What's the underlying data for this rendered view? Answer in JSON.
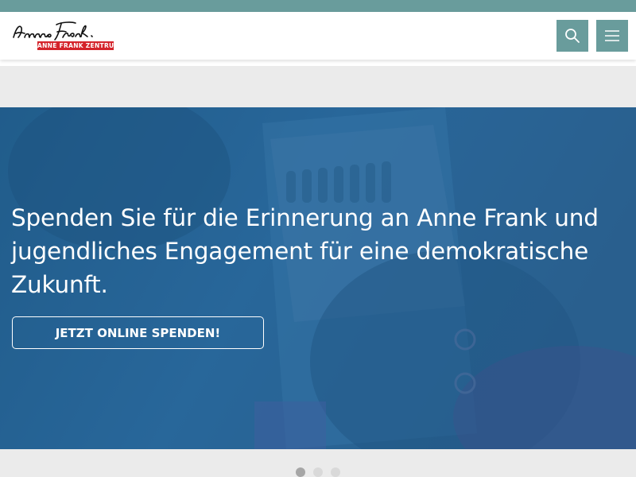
{
  "header": {
    "logo_badge_text": "ANNE FRANK ZENTRUM",
    "icons": {
      "search": "search-icon",
      "menu": "hamburger-menu-icon"
    }
  },
  "colors": {
    "accent": "#699c9c",
    "brand_red": "#d4242b",
    "hero_overlay": "#24608f",
    "band_grey": "#ebebeb"
  },
  "hero": {
    "headline": "Spenden Sie für die Erinnerung an Anne Frank und jugendliches Engagement für eine demokratische Zukunft.",
    "cta_label": "JETZT ONLINE SPENDEN!"
  },
  "carousel": {
    "slide_count": 3,
    "active_index": 0
  }
}
